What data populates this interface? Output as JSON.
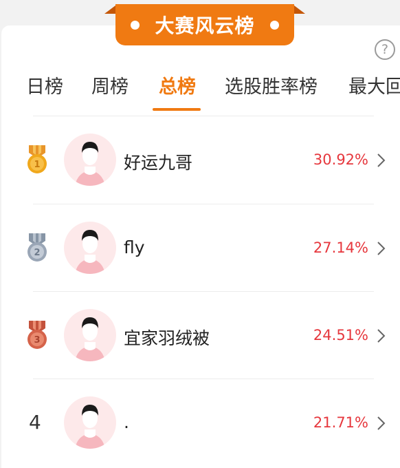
{
  "banner": {
    "title": "大赛风云榜"
  },
  "help": {
    "symbol": "?"
  },
  "tabs": [
    {
      "label": "日榜"
    },
    {
      "label": "周榜"
    },
    {
      "label": "总榜"
    },
    {
      "label": "选股胜率榜"
    },
    {
      "label": "最大回"
    }
  ],
  "active_tab": "总榜",
  "rankings": [
    {
      "rank": "1",
      "medal": "gold-medal-icon",
      "name": "好运九哥",
      "return_pct": "30.92%"
    },
    {
      "rank": "2",
      "medal": "silver-medal-icon",
      "name": "fly",
      "return_pct": "27.14%"
    },
    {
      "rank": "3",
      "medal": "bronze-medal-icon",
      "name": "宜家羽绒被",
      "return_pct": "24.51%"
    },
    {
      "rank": "4",
      "medal": "",
      "name": ".",
      "return_pct": "21.71%"
    }
  ],
  "colors": {
    "accent": "#f07a12",
    "return_red": "#e6373d",
    "gold": "#f0a81c",
    "silver": "#9aa6b6",
    "bronze": "#d5634a"
  }
}
